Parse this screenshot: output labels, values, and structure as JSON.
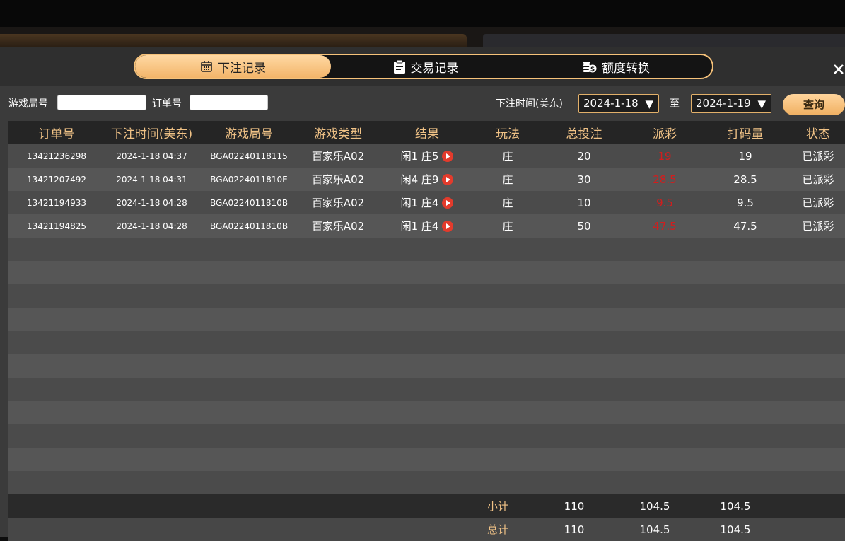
{
  "tabs": [
    {
      "label": "下注记录",
      "icon": "calendar-icon",
      "active": true
    },
    {
      "label": "交易记录",
      "icon": "clipboard-icon",
      "active": false
    },
    {
      "label": "额度转换",
      "icon": "coins-icon",
      "active": false
    }
  ],
  "filter": {
    "round_label": "游戏局号",
    "round_value": "",
    "order_label": "订单号",
    "order_value": "",
    "time_label": "下注时间(美东)",
    "date_from": "2024-1-18",
    "to_label": "至",
    "date_to": "2024-1-19",
    "query_label": "查询"
  },
  "table": {
    "headers": [
      "订单号",
      "下注时间(美东)",
      "游戏局号",
      "游戏类型",
      "结果",
      "玩法",
      "总投注",
      "派彩",
      "打码量",
      "状态"
    ],
    "rows": [
      {
        "order": "13421236298",
        "time": "2024-1-18 04:37",
        "round": "BGA02240118115",
        "game": "百家乐A02",
        "result": "闲1 庄5",
        "play": "庄",
        "bet": "20",
        "payout": "19",
        "code": "19",
        "status": "已派彩"
      },
      {
        "order": "13421207492",
        "time": "2024-1-18 04:31",
        "round": "BGA0224011810E",
        "game": "百家乐A02",
        "result": "闲4 庄9",
        "play": "庄",
        "bet": "30",
        "payout": "28.5",
        "code": "28.5",
        "status": "已派彩"
      },
      {
        "order": "13421194933",
        "time": "2024-1-18 04:28",
        "round": "BGA0224011810B",
        "game": "百家乐A02",
        "result": "闲1 庄4",
        "play": "庄",
        "bet": "10",
        "payout": "9.5",
        "code": "9.5",
        "status": "已派彩"
      },
      {
        "order": "13421194825",
        "time": "2024-1-18 04:28",
        "round": "BGA0224011810B",
        "game": "百家乐A02",
        "result": "闲1 庄4",
        "play": "庄",
        "bet": "50",
        "payout": "47.5",
        "code": "47.5",
        "status": "已派彩"
      }
    ],
    "subtotal": {
      "label": "小计",
      "bet": "110",
      "payout": "104.5",
      "code": "104.5"
    },
    "total": {
      "label": "总计",
      "bet": "110",
      "payout": "104.5",
      "code": "104.5"
    }
  },
  "colors": {
    "accent": "#f3b56a",
    "payout_red": "#d31d1d",
    "header_text": "#f0c286"
  }
}
